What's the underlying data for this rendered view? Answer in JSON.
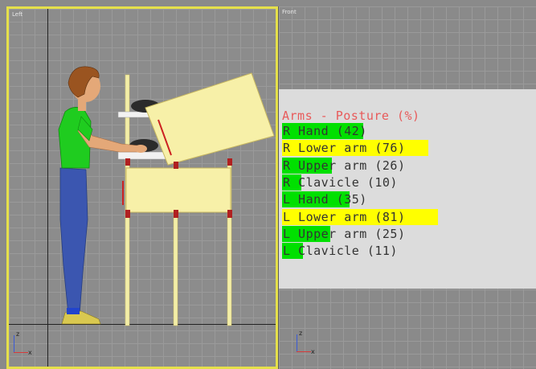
{
  "viewports": {
    "left": {
      "label": "Left"
    },
    "front": {
      "label": "Front"
    }
  },
  "axes": {
    "z": "z",
    "x": "x"
  },
  "colors": {
    "green": "#00e000",
    "yellow": "#ffff00",
    "title_red": "#e85a5a",
    "panel_bg": "#dcdcdc",
    "active_border": "#e5e04a"
  },
  "posture": {
    "title": "Arms - Posture (%)",
    "rows": [
      {
        "label": "R Hand (42)",
        "value": 42,
        "color": "green"
      },
      {
        "label": "R Lower arm (76)",
        "value": 76,
        "color": "yellow"
      },
      {
        "label": "R Upper arm (26)",
        "value": 26,
        "color": "green"
      },
      {
        "label": "R Clavicle (10)",
        "value": 10,
        "color": "green"
      },
      {
        "label": "L Hand (35)",
        "value": 35,
        "color": "green"
      },
      {
        "label": "L Lower arm (81)",
        "value": 81,
        "color": "yellow"
      },
      {
        "label": "L Upper arm (25)",
        "value": 25,
        "color": "green"
      },
      {
        "label": "L Clavicle (11)",
        "value": 11,
        "color": "green"
      }
    ]
  }
}
